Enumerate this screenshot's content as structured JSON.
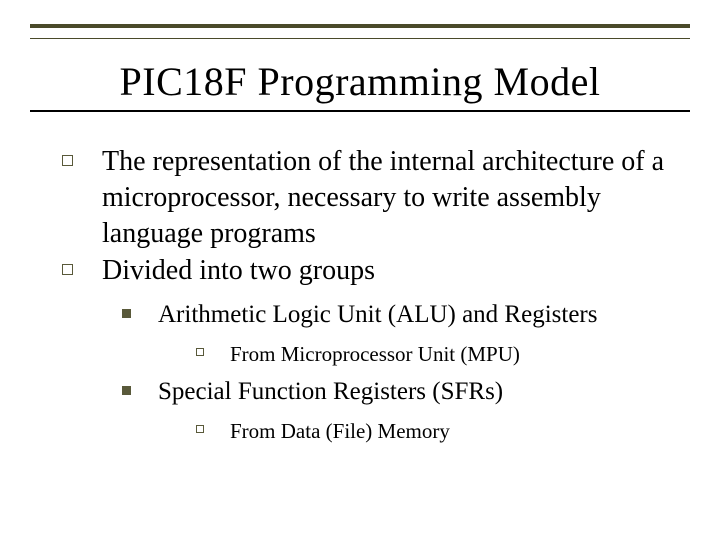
{
  "title": "PIC18F Programming Model",
  "bullets": {
    "level1": [
      "The representation of the internal architecture of a microprocessor, necessary to write assembly language programs",
      "Divided into two groups"
    ],
    "level2": [
      "Arithmetic Logic Unit (ALU) and Registers",
      "Special Function Registers (SFRs)"
    ],
    "level3": [
      "From Microprocessor Unit (MPU)",
      "From Data (File) Memory"
    ]
  },
  "colors": {
    "rule": "#4a4a2a",
    "bulletBorder": "#59593a"
  }
}
